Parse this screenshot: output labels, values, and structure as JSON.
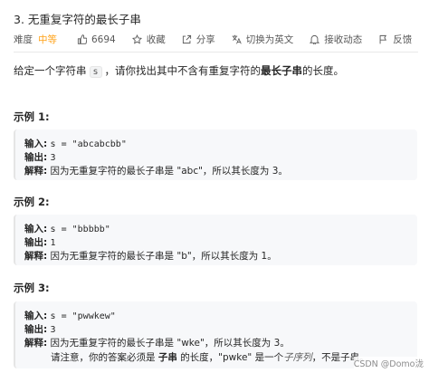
{
  "problem": {
    "title": "3. 无重复字符的最长子串",
    "difficulty_label": "难度",
    "difficulty": "中等",
    "likes": "6694",
    "favorite": "收藏",
    "share": "分享",
    "switch_lang": "切换为英文",
    "notify": "接收动态",
    "feedback": "反馈"
  },
  "description": {
    "before": "给定一个字符串",
    "code": "s",
    "middle": "，请你找出其中不含有重复字符的",
    "bold": "最长子串",
    "after": "的长度。"
  },
  "examples": [
    {
      "heading": "示例 1:",
      "input_label": "输入:",
      "input": "s = \"abcabcbb\"",
      "output_label": "输出:",
      "output": "3",
      "explain_label": "解释:",
      "explain": "因为无重复字符的最长子串是 \"abc\"，所以其长度为 3。"
    },
    {
      "heading": "示例 2:",
      "input_label": "输入:",
      "input": "s = \"bbbbb\"",
      "output_label": "输出:",
      "output": "1",
      "explain_label": "解释:",
      "explain": "因为无重复字符的最长子串是 \"b\"，所以其长度为 1。"
    },
    {
      "heading": "示例 3:",
      "input_label": "输入:",
      "input": "s = \"pwwkew\"",
      "output_label": "输出:",
      "output": "3",
      "explain_label": "解释:",
      "explain": "因为无重复字符的最长子串是 \"wke\"，所以其长度为 3。",
      "note_prefix": "请注意，你的答案必须是",
      "note_bold": "子串",
      "note_middle": "的长度，\"pwke\" 是一个",
      "note_italic": "子序列",
      "note_suffix": "，不是子串。"
    }
  ],
  "watermark": "CSDN @Domo泷",
  "colors": {
    "difficulty_medium": "#ffa116",
    "text": "#262626",
    "muted": "#595959",
    "example_bg": "#f7f8fa"
  }
}
